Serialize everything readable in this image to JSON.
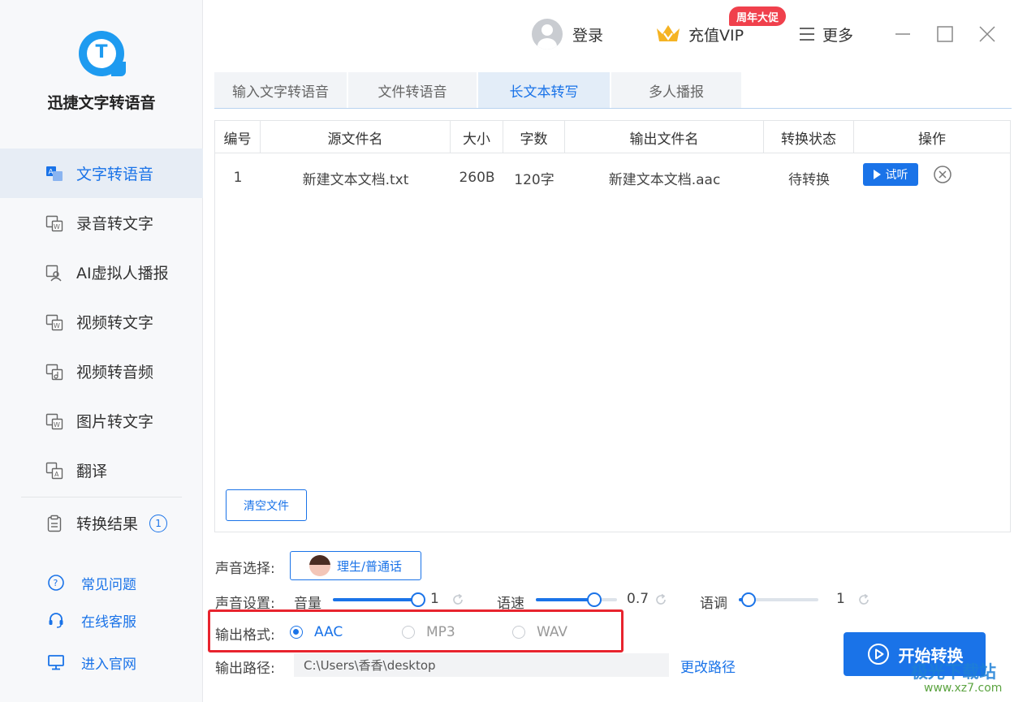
{
  "app": {
    "title": "迅捷文字转语音"
  },
  "sidebar": {
    "items": [
      {
        "label": "文字转语音",
        "icon": "text-to-speech-icon",
        "active": true
      },
      {
        "label": "录音转文字",
        "icon": "audio-to-text-icon"
      },
      {
        "label": "AI虚拟人播报",
        "icon": "ai-avatar-icon"
      },
      {
        "label": "视频转文字",
        "icon": "video-to-text-icon"
      },
      {
        "label": "视频转音频",
        "icon": "video-to-audio-icon"
      },
      {
        "label": "图片转文字",
        "icon": "image-to-text-icon"
      },
      {
        "label": "翻译",
        "icon": "translate-icon"
      },
      {
        "label": "转换结果",
        "icon": "clipboard-icon",
        "badge": "1"
      }
    ],
    "footer": [
      {
        "label": "常见问题",
        "icon": "help-icon"
      },
      {
        "label": "在线客服",
        "icon": "headset-icon"
      },
      {
        "label": "进入官网",
        "icon": "monitor-icon"
      }
    ]
  },
  "topbar": {
    "login": "登录",
    "vip": "充值VIP",
    "promo": "周年大促",
    "more": "更多"
  },
  "tabs": [
    {
      "label": "输入文字转语音"
    },
    {
      "label": "文件转语音"
    },
    {
      "label": "长文本转写",
      "active": true
    },
    {
      "label": "多人播报"
    }
  ],
  "table": {
    "columns": [
      "编号",
      "源文件名",
      "大小",
      "字数",
      "输出文件名",
      "转换状态",
      "操作"
    ],
    "rows": [
      {
        "index": "1",
        "source": "新建文本文档.txt",
        "size": "260B",
        "chars": "120字",
        "output": "新建文本文档.aac",
        "status": "待转换",
        "action": "试听"
      }
    ],
    "clear_label": "清空文件"
  },
  "settings": {
    "voice_label": "声音选择:",
    "voice_value": "理生/普通话",
    "sound_label": "声音设置:",
    "volume_label": "音量",
    "volume_value": "1",
    "volume_level": 0.97,
    "speed_label": "语速",
    "speed_value": "0.7",
    "speed_level": 0.72,
    "pitch_label": "语调",
    "pitch_value": "1",
    "pitch_level": 0.12,
    "format_label": "输出格式:",
    "formats": [
      "AAC",
      "MP3",
      "WAV"
    ],
    "selected_format": "AAC",
    "path_label": "输出路径:",
    "path_value": "C:\\Users\\香香\\desktop",
    "change_path": "更改路径",
    "start_label": "开始转换"
  },
  "watermark": {
    "line1": "极光下载站",
    "line2": "www.xz7.com"
  },
  "colors": {
    "accent": "#1a73e8",
    "highlight": "#e8242e",
    "promo": "#f0404c"
  }
}
